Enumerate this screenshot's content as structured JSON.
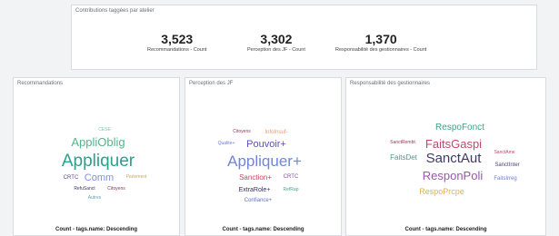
{
  "kpi": {
    "title": "Contributions taggées par atelier",
    "items": [
      {
        "value": "3,523",
        "label": "Recommandations - Count"
      },
      {
        "value": "3,302",
        "label": "Perception des JF - Count"
      },
      {
        "value": "1,370",
        "label": "Responsabilité des gestionnaires - Count"
      }
    ]
  },
  "panels": [
    {
      "title": "Recommandations",
      "footer": "Count - tags.name: Descending",
      "words": [
        {
          "text": "CESE",
          "color": "#82c8b6"
        },
        {
          "text": "AppliOblig",
          "color": "#56b48b"
        },
        {
          "text": "Appliquer",
          "color": "#2ca08c"
        },
        {
          "text": "CRTC",
          "color": "#5f4d82"
        },
        {
          "text": "Comm",
          "color": "#7b93d8"
        },
        {
          "text": "Parlement",
          "color": "#c9a56a"
        },
        {
          "text": "RefuSanct",
          "color": "#3f3a5e"
        },
        {
          "text": "Citoyens",
          "color": "#7a3e56"
        },
        {
          "text": "Autres",
          "color": "#5aa6b4"
        }
      ]
    },
    {
      "title": "Perception des JF",
      "footer": "Count - tags.name: Descending",
      "words": [
        {
          "text": "Citoyens",
          "color": "#a3335b"
        },
        {
          "text": "InfoInsuf-",
          "color": "#e49b72"
        },
        {
          "text": "Qualite+",
          "color": "#6f7bd0"
        },
        {
          "text": "Pouvoir+",
          "color": "#5b4fc5"
        },
        {
          "text": "Appliquer+",
          "color": "#7087d6"
        },
        {
          "text": "Sanction+",
          "color": "#c24b63"
        },
        {
          "text": "CRTC",
          "color": "#8f4aa1"
        },
        {
          "text": "ExtraRole+",
          "color": "#3a2f5f"
        },
        {
          "text": "RefRap",
          "color": "#4aa58a"
        },
        {
          "text": "Confiance+",
          "color": "#5f6fc7"
        }
      ]
    },
    {
      "title": "Responsabilité des gestionnaires",
      "footer": "Count - tags.name: Descending",
      "words": [
        {
          "text": "RespoFonct",
          "color": "#3aa58a"
        },
        {
          "text": "SanctRembt",
          "color": "#a3335b"
        },
        {
          "text": "FaitsGaspi",
          "color": "#c2486a"
        },
        {
          "text": "SanctAme",
          "color": "#c2486a"
        },
        {
          "text": "FaitsDet",
          "color": "#3aa58a"
        },
        {
          "text": "SanctAut",
          "color": "#3d3a63"
        },
        {
          "text": "SanctInter",
          "color": "#4a4478"
        },
        {
          "text": "ResponPoli",
          "color": "#9a55b0"
        },
        {
          "text": "FaitsIrreg",
          "color": "#6f7bd0"
        },
        {
          "text": "RespoPrcpe",
          "color": "#e0b35a"
        }
      ]
    }
  ]
}
